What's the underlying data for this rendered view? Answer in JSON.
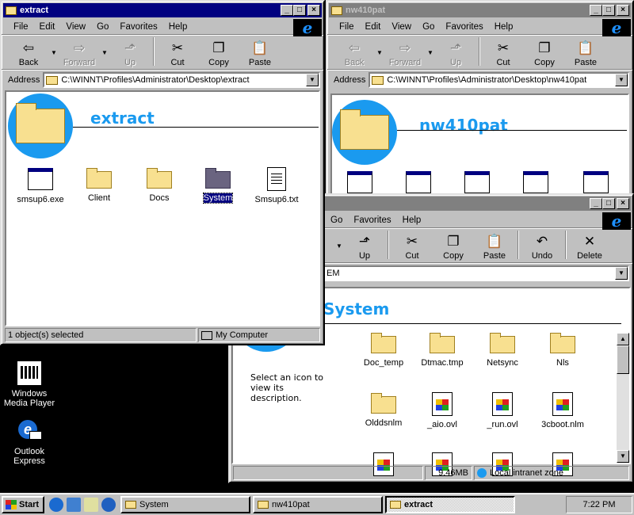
{
  "desktop": {
    "icons": [
      {
        "label_line1": "Windows",
        "label_line2": "Media Player"
      },
      {
        "label_line1": "Outlook",
        "label_line2": "Express"
      }
    ]
  },
  "menu": {
    "file": "File",
    "edit": "Edit",
    "view": "View",
    "go": "Go",
    "favorites": "Favorites",
    "help": "Help"
  },
  "toolbar": {
    "back": "Back",
    "forward": "Forward",
    "up": "Up",
    "cut": "Cut",
    "copy": "Copy",
    "paste": "Paste",
    "undo": "Undo",
    "delete": "Delete"
  },
  "address_label": "Address",
  "window_extract": {
    "title": "extract",
    "address": "C:\\WINNT\\Profiles\\Administrator\\Desktop\\extract",
    "heading": "extract",
    "items": [
      "smsup6.exe",
      "Client",
      "Docs",
      "System",
      "Smsup6.txt"
    ],
    "status_left": "1 object(s) selected",
    "status_right": "My Computer"
  },
  "window_nw410pat": {
    "title": "nw410pat",
    "address": "C:\\WINNT\\Profiles\\Administrator\\Desktop\\nw410pat",
    "heading": "nw410pat"
  },
  "window_system": {
    "address_visible": "EM",
    "heading_visible": "System",
    "description": "Select an icon to view its description.",
    "items": [
      "Doc_temp",
      "Dtmac.tmp",
      "Netsync",
      "Nls",
      "Olddsnlm",
      "_aio.ovl",
      "_run.ovl",
      "3cboot.nlm"
    ],
    "status_size": "9.46MB",
    "status_zone": "Local intranet zone"
  },
  "taskbar": {
    "start": "Start",
    "tasks": [
      "System",
      "nw410pat",
      "extract"
    ],
    "clock": "7:22 PM"
  },
  "colors": {
    "titlebar_active": "#000080",
    "titlebar_inactive": "#808080",
    "banner_blue": "#1a9aef",
    "face": "#c0c0c0"
  }
}
